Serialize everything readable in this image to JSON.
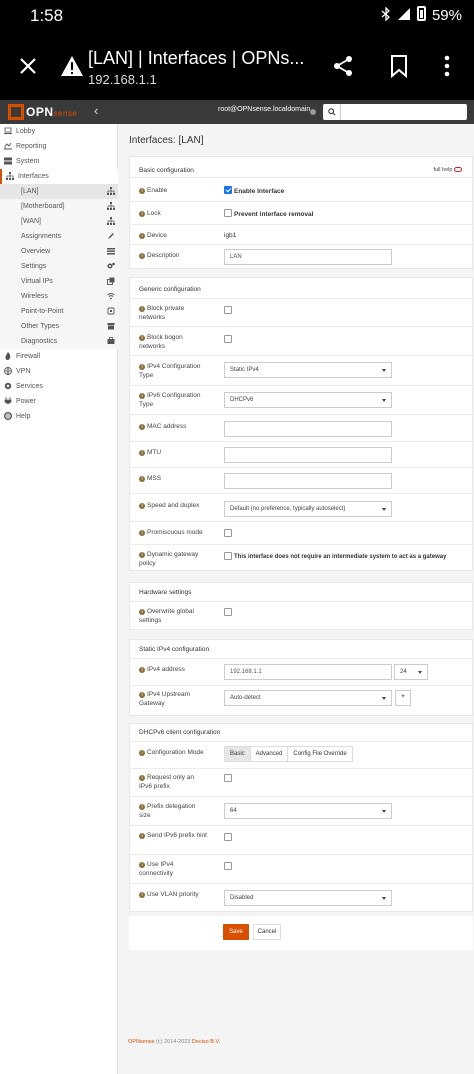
{
  "statusbar": {
    "time": "1:58",
    "battery": "59%"
  },
  "tab": {
    "title": "[LAN] | Interfaces | OPNs...",
    "url": "192.168.1.1"
  },
  "header": {
    "user": "root@OPNsense.localdomain",
    "logo_main": "OPN",
    "logo_sub": "sense"
  },
  "sidebar": {
    "items": [
      {
        "label": "Lobby",
        "icon": "laptop-icon"
      },
      {
        "label": "Reporting",
        "icon": "chart-icon"
      },
      {
        "label": "System",
        "icon": "server-icon"
      },
      {
        "label": "Interfaces",
        "icon": "sitemap-icon"
      },
      {
        "label": "[LAN]",
        "icon": "sitemap-icon"
      },
      {
        "label": "[Motherboard]",
        "icon": "sitemap-icon"
      },
      {
        "label": "[WAN]",
        "icon": "sitemap-icon"
      },
      {
        "label": "Assignments",
        "icon": "pencil-icon"
      },
      {
        "label": "Overview",
        "icon": "tasks-icon"
      },
      {
        "label": "Settings",
        "icon": "cogs-icon"
      },
      {
        "label": "Virtual IPs",
        "icon": "clone-icon"
      },
      {
        "label": "Wireless",
        "icon": "wifi-icon"
      },
      {
        "label": "Point-to-Point",
        "icon": "plug-icon"
      },
      {
        "label": "Other Types",
        "icon": "archive-icon"
      },
      {
        "label": "Diagnostics",
        "icon": "medkit-icon"
      },
      {
        "label": "Firewall",
        "icon": "fire-icon"
      },
      {
        "label": "VPN",
        "icon": "globe-icon"
      },
      {
        "label": "Services",
        "icon": "cog-icon"
      },
      {
        "label": "Power",
        "icon": "plug-icon"
      },
      {
        "label": "Help",
        "icon": "lifebuoy-icon"
      }
    ]
  },
  "page": {
    "title": "Interfaces: [LAN]",
    "full_help": "full help",
    "basic": {
      "heading": "Basic configuration",
      "enable_label": "Enable",
      "enable_text": "Enable Interface",
      "lock_label": "Lock",
      "lock_text": "Prevent interface removal",
      "device_label": "Device",
      "device_value": "igb1",
      "description_label": "Description",
      "description_value": "LAN"
    },
    "generic": {
      "heading": "Generic configuration",
      "block_private": "Block private networks",
      "block_bogon": "Block bogon networks",
      "ipv4_type_label": "IPv4 Configuration Type",
      "ipv4_type_value": "Static IPv4",
      "ipv6_type_label": "IPv6 Configuration Type",
      "ipv6_type_value": "DHCPv6",
      "mac_label": "MAC address",
      "mtu_label": "MTU",
      "mss_label": "MSS",
      "speed_label": "Speed and duplex",
      "speed_value": "Default (no preference, typically autoselect)",
      "promisc_label": "Promiscuous mode",
      "dyngw_label": "Dynamic gateway policy",
      "dyngw_text": "This interface does not require an intermediate system to act as a gateway"
    },
    "hardware": {
      "heading": "Hardware settings",
      "override_label": "Overwrite global settings"
    },
    "static4": {
      "heading": "Static IPv4 configuration",
      "addr_label": "IPv4 address",
      "addr_value": "192.168.1.1",
      "cidr_value": "24",
      "gw_label": "IPv4 Upstream Gateway",
      "gw_value": "Auto-detect",
      "add_gw": "+"
    },
    "dhcp6": {
      "heading": "DHCPv6 client configuration",
      "mode_label": "Configuration Mode",
      "modes": [
        "Basic",
        "Advanced",
        "Config File Override"
      ],
      "req_prefix_label": "Request only an IPv6 prefix",
      "prefix_size_label": "Prefix delegation size",
      "prefix_size_value": "64",
      "send_hint_label": "Send IPv6 prefix hint",
      "use_ipv4_label": "Use IPv4 connectivity",
      "vlan_prio_label": "Use VLAN priority",
      "vlan_prio_value": "Disabled"
    },
    "save": "Save",
    "cancel": "Cancel",
    "footer_brand": "OPNsense",
    "footer_mid": " (c) 2014-2023 ",
    "footer_company": "Deciso B.V."
  }
}
